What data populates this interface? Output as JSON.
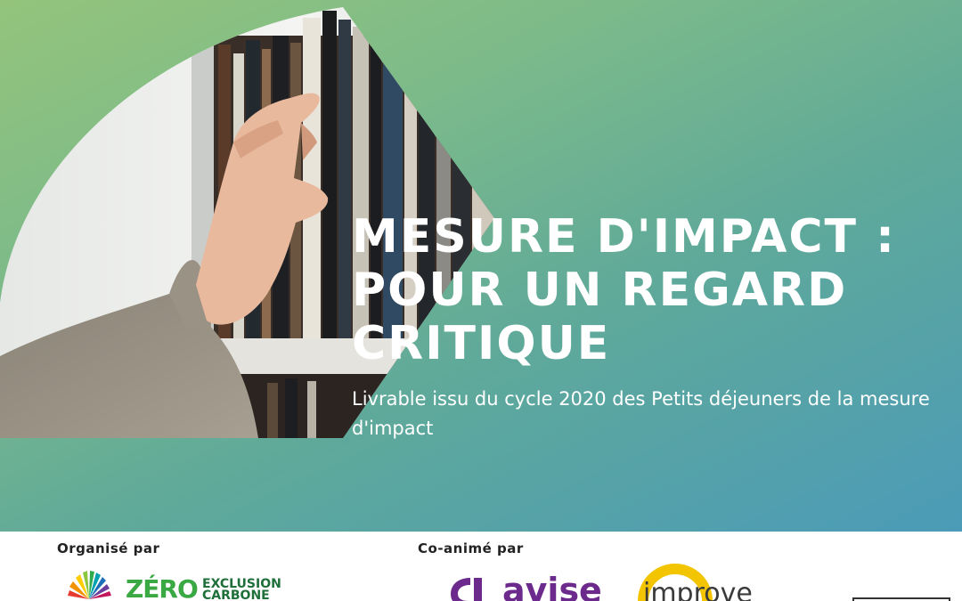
{
  "hero": {
    "title": "MESURE D'IMPACT : POUR UN REGARD CRITIQUE",
    "subtitle": "Livrable issu du cycle 2020 des Petits déjeuners de la mesure d'impact"
  },
  "footer": {
    "organized_label": "Organisé par",
    "coanimated_label": "Co-animé par",
    "logos": {
      "zero_line1": "ZÉRO",
      "zero_line2a": "EXCLUSION",
      "zero_line2b": "CARBONE",
      "avise": "avise",
      "improve": "improve"
    }
  },
  "colors": {
    "gradient_top_left": "#94c47c",
    "gradient_bottom_right": "#4b9bb8",
    "title_text": "#ffffff",
    "avise_purple": "#6b2a8c",
    "improve_yellow": "#f2c500",
    "zero_green": "#3aa843"
  }
}
